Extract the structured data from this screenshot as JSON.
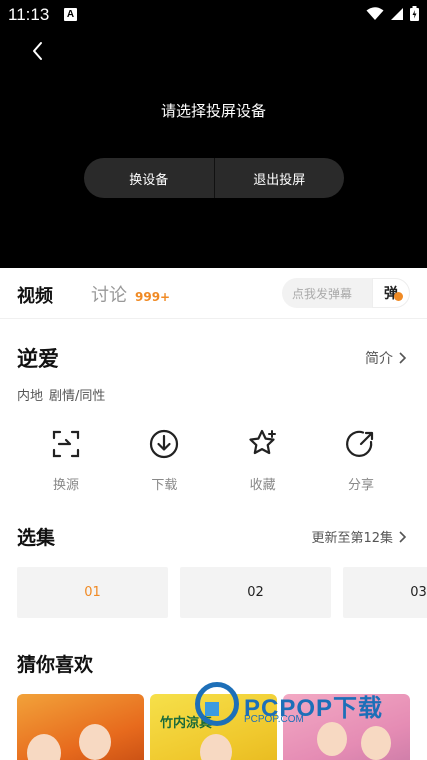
{
  "status_bar": {
    "time": "11:13",
    "notification_glyph": "A"
  },
  "player": {
    "cast_prompt": "请选择投屏设备",
    "switch_device_label": "换设备",
    "exit_cast_label": "退出投屏"
  },
  "tabs": {
    "video_label": "视频",
    "discuss_label": "讨论",
    "discuss_count": "999+",
    "danmaku_placeholder": "点我发弹幕",
    "danmaku_toggle_label": "弹"
  },
  "show": {
    "title": "逆爱",
    "intro_label": "简介",
    "tags": [
      "内地",
      "剧情/同性"
    ]
  },
  "actions": [
    {
      "label": "换源",
      "icon": "switch-source-icon"
    },
    {
      "label": "下载",
      "icon": "download-icon"
    },
    {
      "label": "收藏",
      "icon": "favorite-star-icon"
    },
    {
      "label": "分享",
      "icon": "share-icon"
    }
  ],
  "episodes": {
    "title": "选集",
    "update_text": "更新至第12集",
    "items": [
      "01",
      "02",
      "03"
    ],
    "selected": "01"
  },
  "recommend": {
    "title": "猜你喜欢",
    "card_captions": [
      "",
      "竹内涼真",
      ""
    ]
  },
  "watermark": {
    "text": "PCPOP下载",
    "sub": "PCPOP.COM"
  },
  "colors": {
    "accent": "#f08a24",
    "background": "#ffffff",
    "player_bg": "#000000"
  }
}
